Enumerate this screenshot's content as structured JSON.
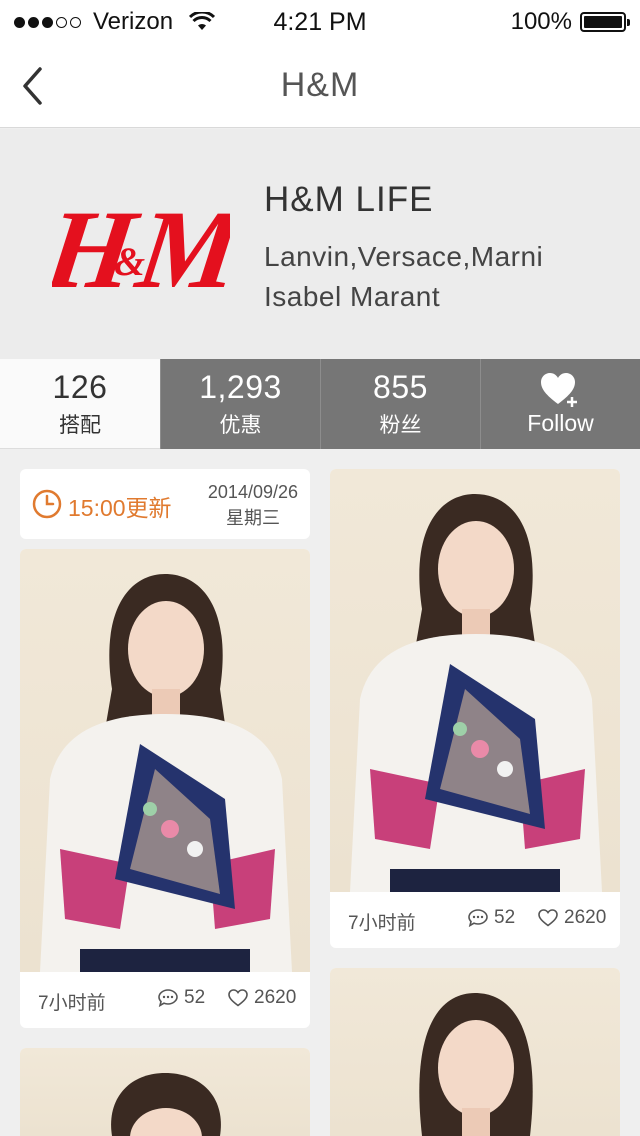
{
  "status_bar": {
    "carrier": "Verizon",
    "time": "4:21 PM",
    "battery": "100%",
    "battery_level": 1.0
  },
  "nav": {
    "title": "H&M"
  },
  "brand": {
    "logo_text": "H&M",
    "logo_color": "#e4101e",
    "name": "H&M LIFE",
    "designers_line1": "Lanvin,Versace,Marni",
    "designers_line2": "Isabel Marant"
  },
  "stats": [
    {
      "value": "126",
      "label": "搭配"
    },
    {
      "value": "1,293",
      "label": "优惠"
    },
    {
      "value": "855",
      "label": "粉丝"
    }
  ],
  "follow": {
    "label": "Follow",
    "icon": "heart-plus-icon"
  },
  "update": {
    "time_label": "15:00更新",
    "date": "2014/09/26",
    "weekday": "星期三",
    "accent_color": "#e07a2f"
  },
  "posts": [
    {
      "time_ago": "7小时前",
      "comments": "52",
      "likes": "2620"
    },
    {
      "time_ago": "7小时前",
      "comments": "52",
      "likes": "2620"
    }
  ]
}
